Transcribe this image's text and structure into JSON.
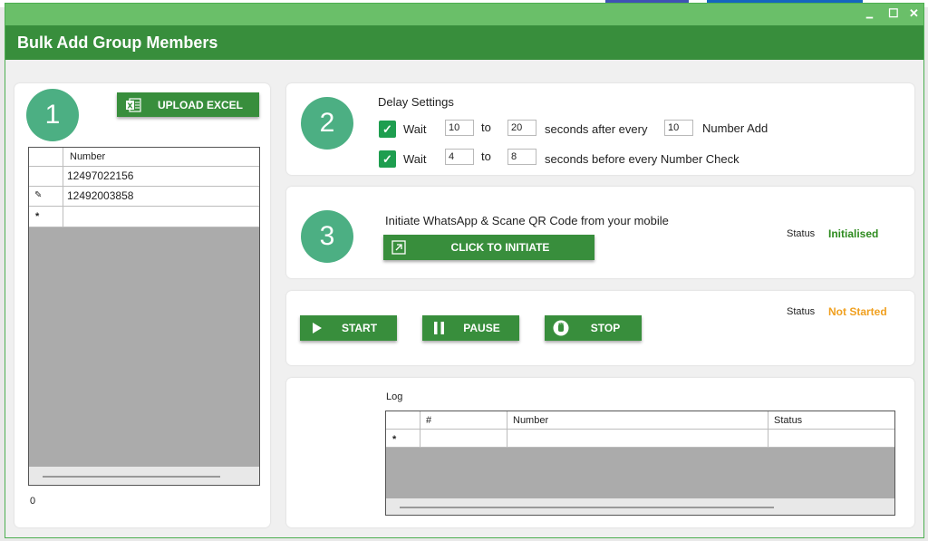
{
  "window": {
    "title": "Bulk Add Group Members",
    "controls": {
      "minimize": "▁",
      "maximize": "☐",
      "close": "✕"
    }
  },
  "upload": {
    "step": "1",
    "button_label": "UPLOAD EXCEL",
    "grid_header": "Number",
    "rows": [
      "12497022156",
      "12492003858",
      ""
    ],
    "row_marks": [
      "",
      "✎",
      "*"
    ],
    "count": "0"
  },
  "delay": {
    "step": "2",
    "title": "Delay Settings",
    "row1": {
      "wait": "Wait",
      "from": "10",
      "to_label": "to",
      "to": "20",
      "middle": "seconds after every",
      "every": "10",
      "suffix": "Number Add"
    },
    "row2": {
      "wait": "Wait",
      "from": "4",
      "to_label": "to",
      "to": "8",
      "suffix": "seconds before every Number Check"
    }
  },
  "initiate": {
    "step": "3",
    "instruction": "Initiate WhatsApp & Scane QR Code from your mobile",
    "button_label": "CLICK TO INITIATE",
    "status_label": "Status",
    "status_value": "Initialised",
    "status_color": "#2e8b1f"
  },
  "controls": {
    "start_label": "START",
    "pause_label": "PAUSE",
    "stop_label": "STOP",
    "status_label": "Status",
    "status_value": "Not Started",
    "status_color": "#f0a020"
  },
  "log": {
    "title": "Log",
    "columns": [
      "#",
      "Number",
      "Status"
    ],
    "new_row_mark": "*"
  },
  "colors": {
    "header_green": "#388e3c",
    "titlebar_green": "#6abf69",
    "circle_green": "#4caf83",
    "check_green": "#1e9e4f"
  }
}
